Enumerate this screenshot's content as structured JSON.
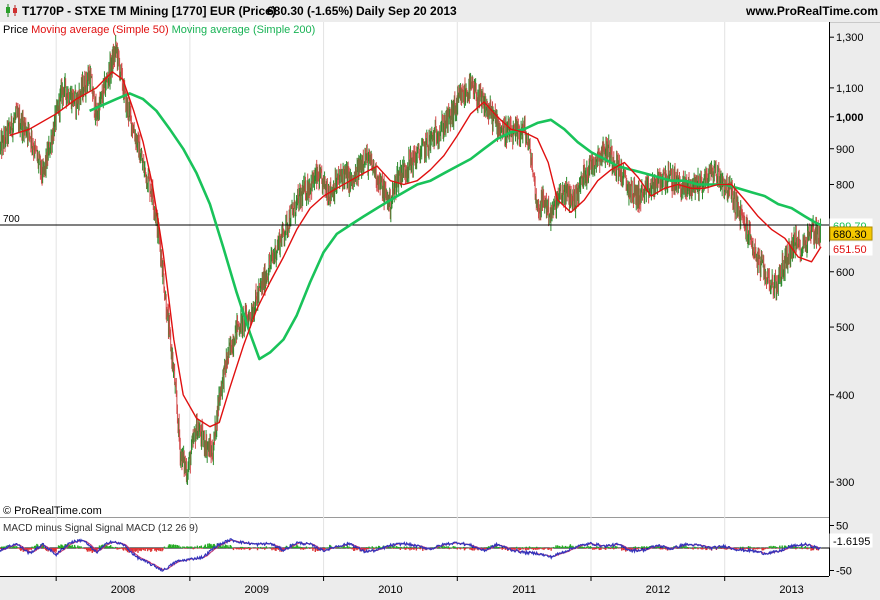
{
  "header": {
    "symbol": "T1770P - STXE TM Mining [1770] EUR (Price)",
    "last": "680.30 (-1.65%)",
    "period": "Daily  Sep 20 2013",
    "site": "www.ProRealTime.com"
  },
  "legend": {
    "price": "Price",
    "ma50": "Moving average (Simple 50)",
    "ma200": "Moving average (Simple 200)"
  },
  "watermark": "© ProRealTime.com",
  "colors": {
    "price_up": "#2e8b2e",
    "price_down": "#d24a4a",
    "ma50": "#e01010",
    "ma200": "#19c35a",
    "macd": "#3333bb",
    "signal": "#c03070",
    "hist_pos": "#22aa22",
    "hist_neg": "#dd3333"
  },
  "chart_data": [
    {
      "type": "line",
      "title": "STXE TM Mining [1770] EUR (Price)",
      "scale": "log",
      "ylim": [
        270,
        1340
      ],
      "y_ticks": [
        "1,300",
        "1,100",
        "1,000",
        "900",
        "800",
        "700",
        "600",
        "500",
        "400",
        "300"
      ],
      "x_ticks": [
        "2008",
        "2009",
        "2010",
        "2011",
        "2012",
        "2013"
      ],
      "reference_line": {
        "label": "700",
        "value": 700
      },
      "last_labels": {
        "ma200": "699.79",
        "price": "680.30",
        "ma50": "651.50"
      },
      "series": [
        {
          "name": "Price",
          "x": [
            2007.58,
            2007.7,
            2007.8,
            2007.9,
            2008.05,
            2008.15,
            2008.25,
            2008.3,
            2008.38,
            2008.45,
            2008.52,
            2008.58,
            2008.65,
            2008.72,
            2008.78,
            2008.83,
            2008.88,
            2008.93,
            2008.98,
            2009.05,
            2009.12,
            2009.17,
            2009.22,
            2009.28,
            2009.35,
            2009.45,
            2009.55,
            2009.65,
            2009.75,
            2009.85,
            2009.95,
            2010.05,
            2010.15,
            2010.22,
            2010.3,
            2010.38,
            2010.45,
            2010.5,
            2010.55,
            2010.65,
            2010.75,
            2010.85,
            2010.95,
            2011.02,
            2011.1,
            2011.18,
            2011.25,
            2011.33,
            2011.42,
            2011.5,
            2011.55,
            2011.6,
            2011.65,
            2011.7,
            2011.75,
            2011.8,
            2011.88,
            2011.95,
            2012.05,
            2012.12,
            2012.2,
            2012.28,
            2012.35,
            2012.42,
            2012.48,
            2012.55,
            2012.62,
            2012.7,
            2012.78,
            2012.85,
            2012.92,
            2013.0,
            2013.05,
            2013.12,
            2013.18,
            2013.25,
            2013.32,
            2013.38,
            2013.45,
            2013.52,
            2013.58,
            2013.65,
            2013.72
          ],
          "values": [
            900,
            1000,
            950,
            820,
            1100,
            1050,
            1150,
            1000,
            1130,
            1250,
            1050,
            960,
            850,
            780,
            650,
            520,
            430,
            330,
            310,
            360,
            340,
            330,
            400,
            450,
            500,
            520,
            580,
            650,
            720,
            780,
            820,
            780,
            830,
            800,
            880,
            840,
            780,
            750,
            820,
            860,
            900,
            950,
            1000,
            1060,
            1100,
            1050,
            1010,
            960,
            940,
            960,
            880,
            740,
            760,
            720,
            760,
            780,
            760,
            830,
            880,
            900,
            850,
            790,
            770,
            780,
            800,
            820,
            810,
            790,
            800,
            810,
            840,
            800,
            780,
            720,
            680,
            620,
            590,
            570,
            620,
            660,
            650,
            690,
            680.3
          ]
        },
        {
          "name": "Moving average (Simple 50)",
          "x": [
            2007.65,
            2007.8,
            2008.0,
            2008.15,
            2008.3,
            2008.42,
            2008.5,
            2008.58,
            2008.65,
            2008.72,
            2008.8,
            2008.88,
            2008.95,
            2009.05,
            2009.15,
            2009.22,
            2009.3,
            2009.4,
            2009.5,
            2009.6,
            2009.7,
            2009.8,
            2009.9,
            2010.0,
            2010.1,
            2010.2,
            2010.3,
            2010.4,
            2010.5,
            2010.6,
            2010.7,
            2010.8,
            2010.9,
            2011.0,
            2011.1,
            2011.2,
            2011.3,
            2011.4,
            2011.5,
            2011.6,
            2011.68,
            2011.75,
            2011.85,
            2011.95,
            2012.05,
            2012.15,
            2012.25,
            2012.35,
            2012.45,
            2012.55,
            2012.65,
            2012.75,
            2012.85,
            2012.95,
            2013.05,
            2013.15,
            2013.25,
            2013.35,
            2013.45,
            2013.55,
            2013.65,
            2013.72
          ],
          "values": [
            940,
            960,
            1010,
            1060,
            1100,
            1160,
            1130,
            1020,
            920,
            800,
            640,
            480,
            400,
            370,
            360,
            365,
            410,
            470,
            530,
            580,
            630,
            690,
            740,
            770,
            790,
            810,
            830,
            850,
            810,
            800,
            810,
            840,
            880,
            940,
            1010,
            1050,
            1000,
            960,
            950,
            930,
            860,
            760,
            730,
            760,
            810,
            840,
            860,
            820,
            770,
            790,
            800,
            790,
            790,
            800,
            800,
            760,
            720,
            690,
            670,
            630,
            620,
            651.5
          ]
        },
        {
          "name": "Moving average (Simple 200)",
          "x": [
            2008.25,
            2008.35,
            2008.45,
            2008.55,
            2008.65,
            2008.75,
            2008.85,
            2008.95,
            2009.05,
            2009.15,
            2009.25,
            2009.35,
            2009.45,
            2009.52,
            2009.6,
            2009.7,
            2009.8,
            2009.9,
            2010.0,
            2010.1,
            2010.2,
            2010.3,
            2010.4,
            2010.5,
            2010.6,
            2010.7,
            2010.8,
            2010.9,
            2011.0,
            2011.1,
            2011.2,
            2011.3,
            2011.4,
            2011.5,
            2011.6,
            2011.7,
            2011.8,
            2011.9,
            2012.0,
            2012.1,
            2012.2,
            2012.3,
            2012.4,
            2012.5,
            2012.6,
            2012.7,
            2012.8,
            2012.9,
            2013.0,
            2013.1,
            2013.2,
            2013.3,
            2013.4,
            2013.5,
            2013.6,
            2013.68,
            2013.72
          ],
          "values": [
            1020,
            1040,
            1060,
            1080,
            1060,
            1020,
            960,
            900,
            830,
            750,
            650,
            560,
            490,
            450,
            460,
            480,
            520,
            580,
            640,
            680,
            700,
            720,
            740,
            760,
            780,
            800,
            810,
            830,
            850,
            870,
            900,
            930,
            950,
            960,
            980,
            990,
            960,
            920,
            890,
            870,
            850,
            840,
            830,
            820,
            810,
            810,
            800,
            800,
            800,
            790,
            780,
            770,
            750,
            740,
            720,
            705,
            699.79
          ]
        }
      ]
    },
    {
      "type": "line",
      "title": "MACD minus Signal  Signal  MACD (12 26 9)",
      "ylim": [
        -60,
        60
      ],
      "y_ticks": [
        "50",
        "-50"
      ],
      "last_labels": {
        "macd": "-1.6195"
      },
      "series": [
        {
          "name": "MACD (12 26 9)",
          "x": [
            2007.58,
            2007.7,
            2007.8,
            2007.9,
            2008.0,
            2008.1,
            2008.2,
            2008.3,
            2008.4,
            2008.5,
            2008.6,
            2008.7,
            2008.8,
            2008.9,
            2009.0,
            2009.1,
            2009.2,
            2009.3,
            2009.4,
            2009.5,
            2009.6,
            2009.7,
            2009.8,
            2009.9,
            2010.0,
            2010.1,
            2010.2,
            2010.3,
            2010.4,
            2010.5,
            2010.6,
            2010.7,
            2010.8,
            2010.9,
            2011.0,
            2011.1,
            2011.2,
            2011.3,
            2011.4,
            2011.5,
            2011.6,
            2011.7,
            2011.8,
            2011.9,
            2012.0,
            2012.1,
            2012.2,
            2012.3,
            2012.4,
            2012.5,
            2012.6,
            2012.7,
            2012.8,
            2012.9,
            2013.0,
            2013.1,
            2013.2,
            2013.3,
            2013.4,
            2013.5,
            2013.6,
            2013.72
          ],
          "values": [
            -5,
            10,
            -12,
            8,
            -15,
            12,
            18,
            -10,
            15,
            8,
            -20,
            -35,
            -50,
            -30,
            -25,
            -20,
            5,
            18,
            12,
            8,
            10,
            -5,
            12,
            8,
            -6,
            4,
            10,
            -8,
            -5,
            6,
            10,
            4,
            -2,
            8,
            12,
            6,
            -6,
            8,
            -4,
            -10,
            -12,
            -20,
            -8,
            4,
            10,
            4,
            8,
            -6,
            -4,
            6,
            -2,
            8,
            6,
            0,
            4,
            -4,
            -6,
            -12,
            -8,
            4,
            8,
            -1.6
          ]
        }
      ]
    }
  ]
}
